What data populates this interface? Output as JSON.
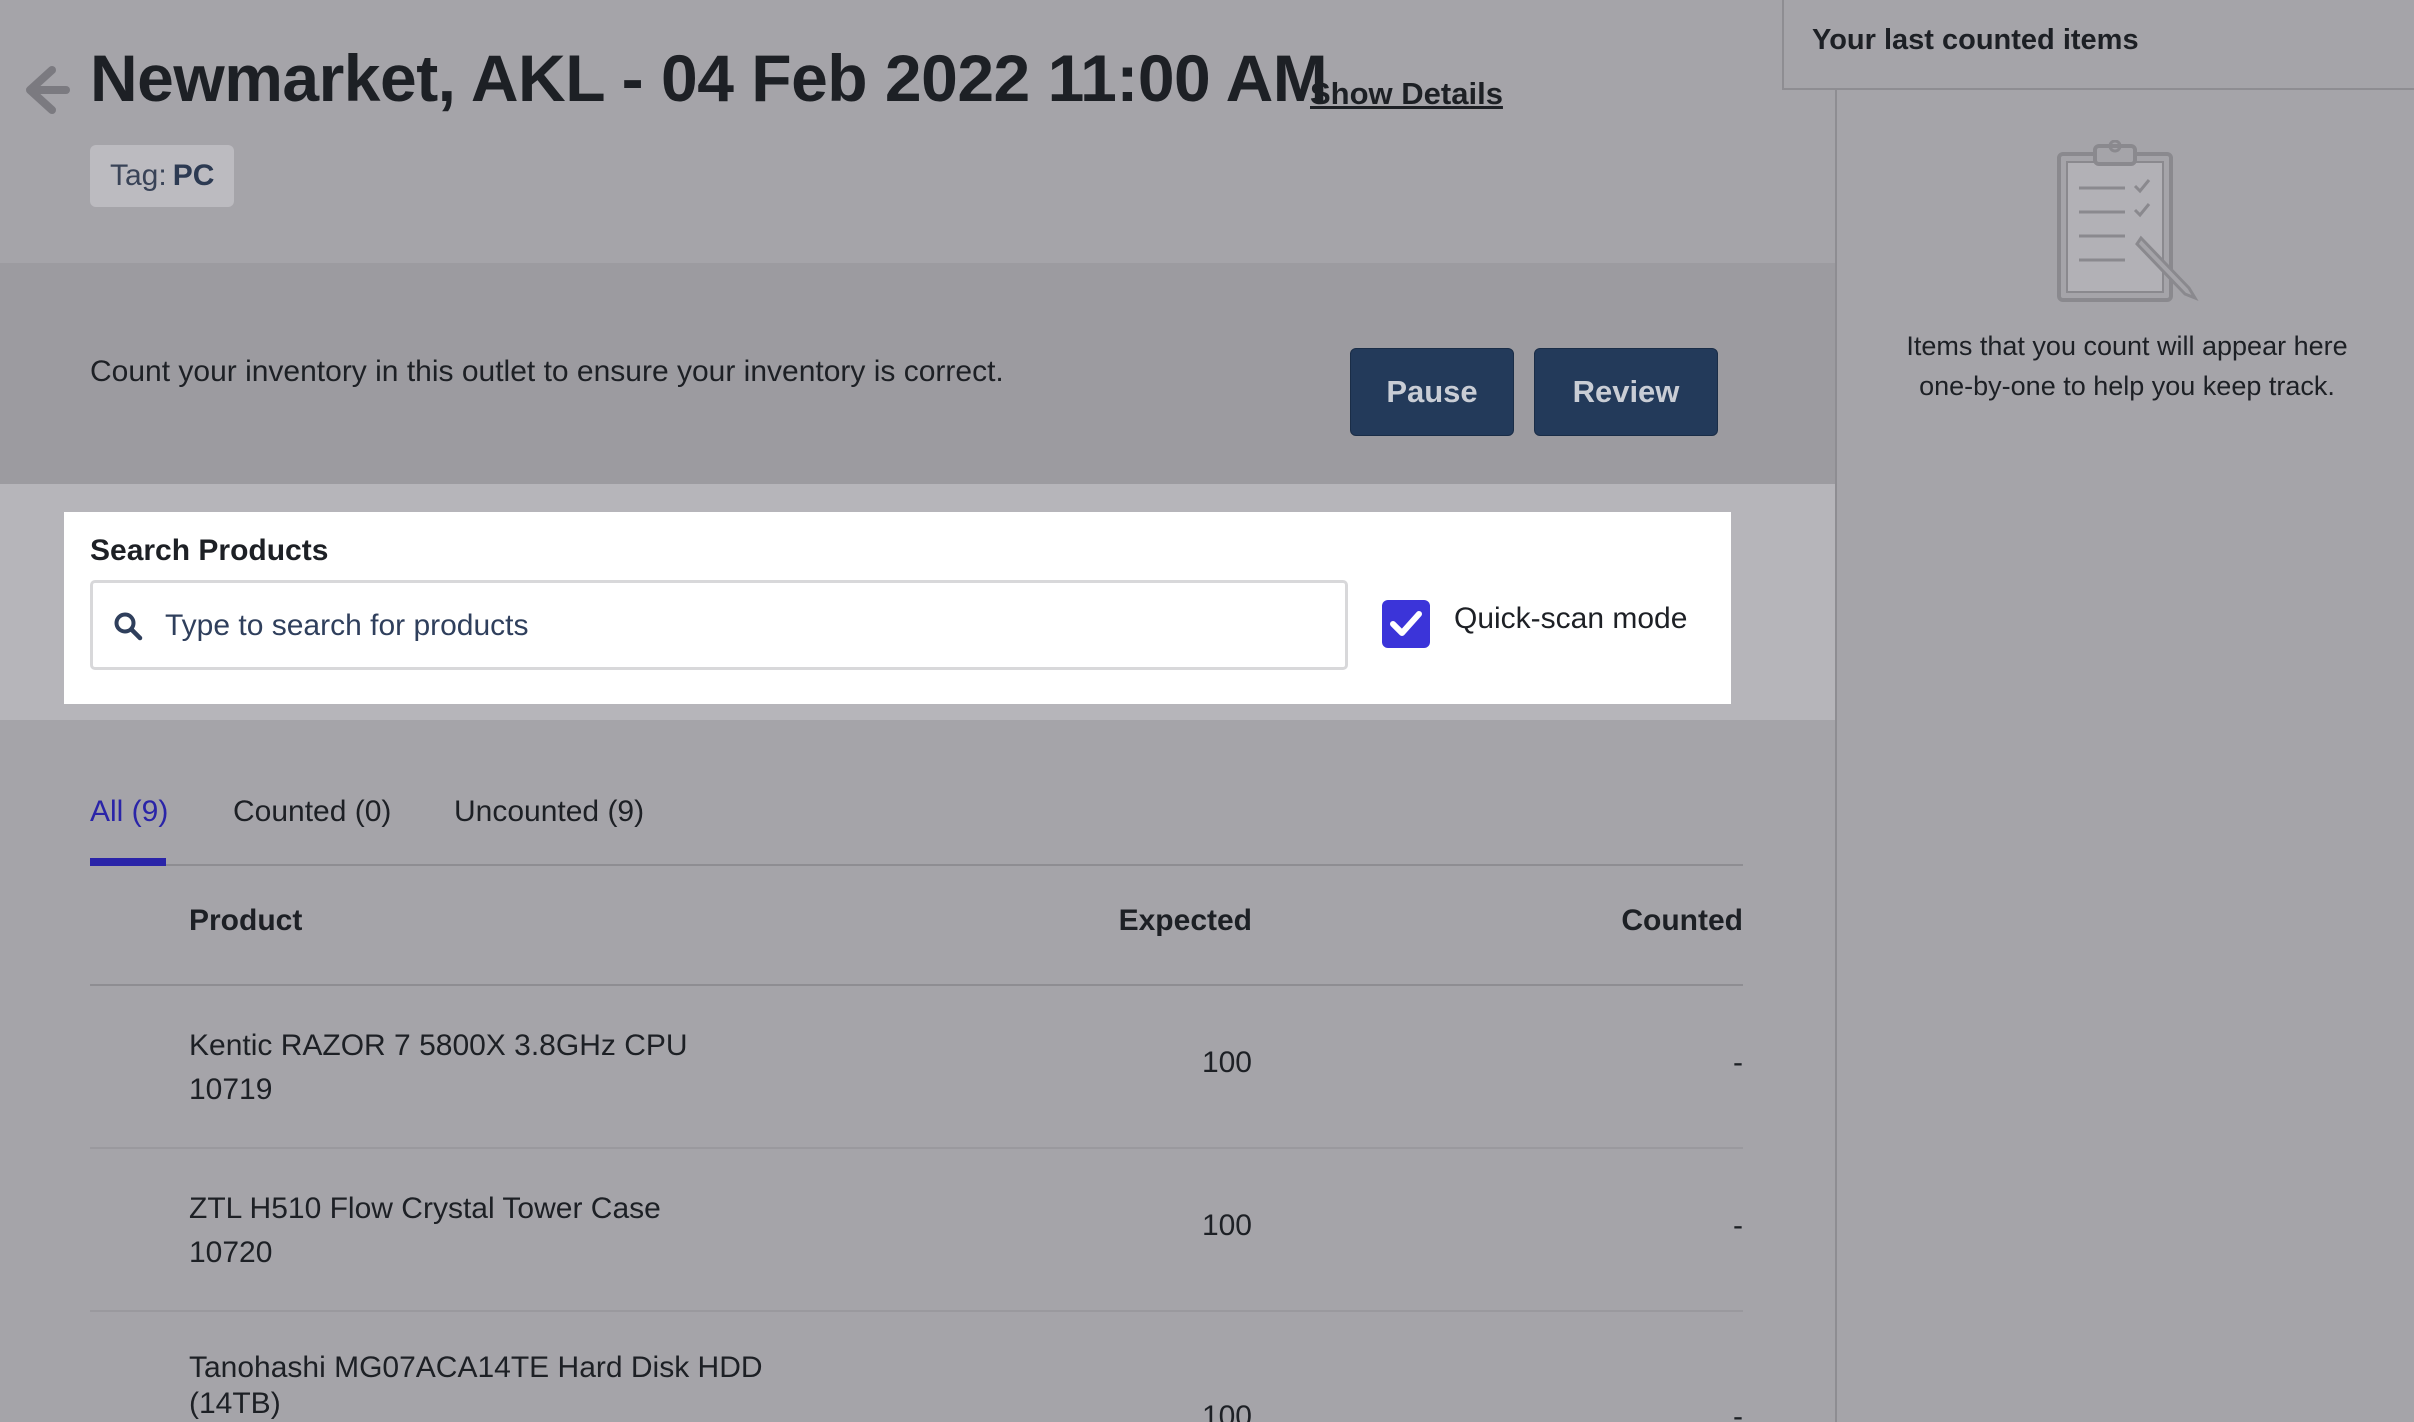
{
  "header": {
    "title": "Newmarket, AKL - 04 Feb 2022 11:00 AM",
    "show_details_label": "Show Details",
    "tag_label": "Tag:",
    "tag_value": "PC"
  },
  "banner": {
    "text": "Count your inventory in this outlet to ensure your inventory is correct.",
    "pause_label": "Pause",
    "review_label": "Review"
  },
  "search": {
    "label": "Search Products",
    "placeholder": "Type to search for products",
    "value": "",
    "quick_scan_label": "Quick-scan mode",
    "quick_scan_checked": true
  },
  "tabs": [
    {
      "label": "All (9)",
      "active": true
    },
    {
      "label": "Counted (0)",
      "active": false
    },
    {
      "label": "Uncounted (9)",
      "active": false
    }
  ],
  "table": {
    "columns": {
      "product": "Product",
      "expected": "Expected",
      "counted": "Counted"
    },
    "rows": [
      {
        "name": "Kentic RAZOR 7 5800X 3.8GHz CPU",
        "sku": "10719",
        "expected": "100",
        "counted": "-"
      },
      {
        "name": "ZTL H510 Flow Crystal Tower Case",
        "sku": "10720",
        "expected": "100",
        "counted": "-"
      },
      {
        "name": "Tanohashi MG07ACA14TE Hard Disk HDD (14TB)",
        "sku": "",
        "expected": "100",
        "counted": "-"
      }
    ]
  },
  "side_panel": {
    "title": "Your last counted items",
    "empty_text": "Items that you count will appear here one-by-one to help you keep track.",
    "icon": "clipboard-icon"
  },
  "colors": {
    "accent": "#3b34d9",
    "active_tab": "#2a24a8",
    "button_bg": "#233a5a",
    "overlay_bg": "#a5a4a9"
  }
}
